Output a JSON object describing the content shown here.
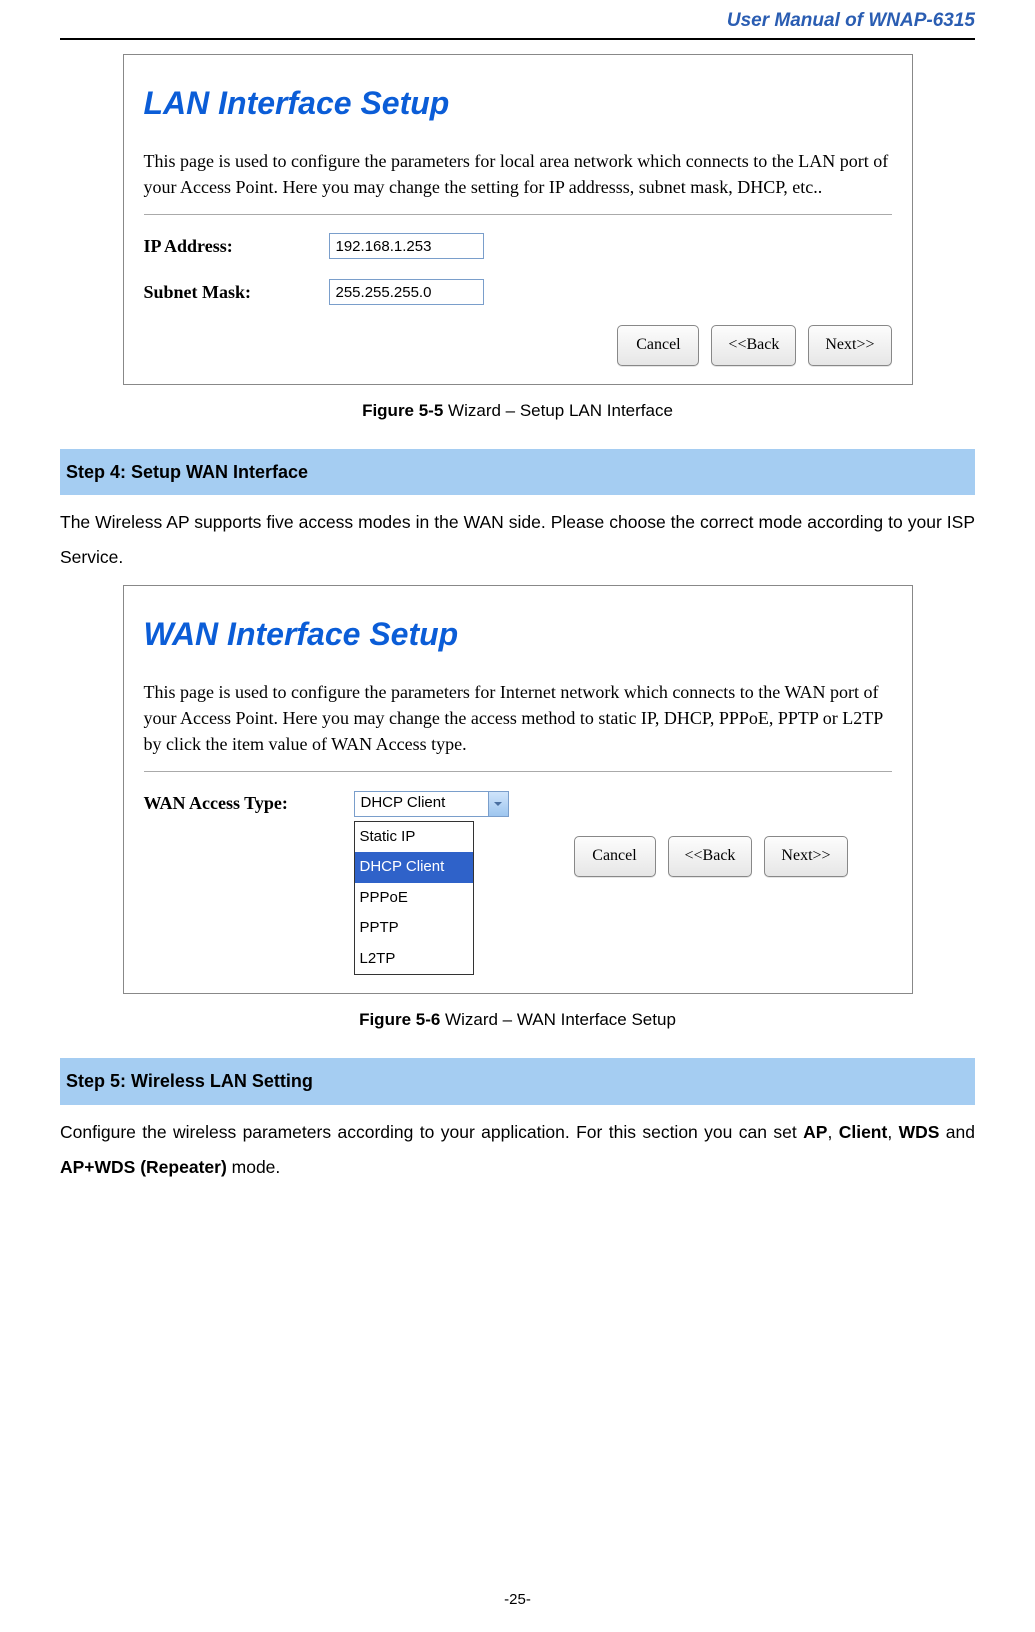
{
  "header": {
    "title": "User Manual of WNAP-6315"
  },
  "lan": {
    "title": "LAN Interface Setup",
    "desc": "This page is used to configure the parameters for local area network which connects to the LAN port of your Access Point. Here you may change the setting for IP addresss, subnet mask, DHCP, etc..",
    "ip_label": "IP Address:",
    "ip_value": "192.168.1.253",
    "mask_label": "Subnet Mask:",
    "mask_value": "255.255.255.0",
    "btn_cancel": "Cancel",
    "btn_back": "<<Back",
    "btn_next": "Next>>"
  },
  "caption1_bold": "Figure 5-5",
  "caption1_rest": " Wizard – Setup LAN Interface",
  "step4": {
    "title": "Step 4: Setup WAN Interface",
    "body": "The Wireless AP supports five access modes in the WAN side. Please choose the correct mode according to your ISP Service."
  },
  "wan": {
    "title": "WAN Interface Setup",
    "desc": "This page is used to configure the parameters for Internet network which connects to the WAN port of your Access Point. Here you may change the access method to static IP, DHCP, PPPoE, PPTP or L2TP by click the item value of WAN Access type.",
    "label": "WAN Access Type:",
    "selected": "DHCP Client",
    "options": [
      "Static IP",
      "DHCP Client",
      "PPPoE",
      "PPTP",
      "L2TP"
    ],
    "btn_cancel": "Cancel",
    "btn_back": "<<Back",
    "btn_next": "Next>>"
  },
  "caption2_bold": "Figure 5-6",
  "caption2_rest": " Wizard – WAN Interface Setup",
  "step5": {
    "title": "Step 5: Wireless LAN Setting",
    "body_pre": "Configure the wireless parameters according to your application. For this section you can set ",
    "ap": "AP",
    "sep1": ", ",
    "client": "Client",
    "sep2": ", ",
    "wds": "WDS",
    "sep3": " and ",
    "repeater": "AP+WDS (Repeater)",
    "body_post": " mode."
  },
  "page_num": "-25-"
}
